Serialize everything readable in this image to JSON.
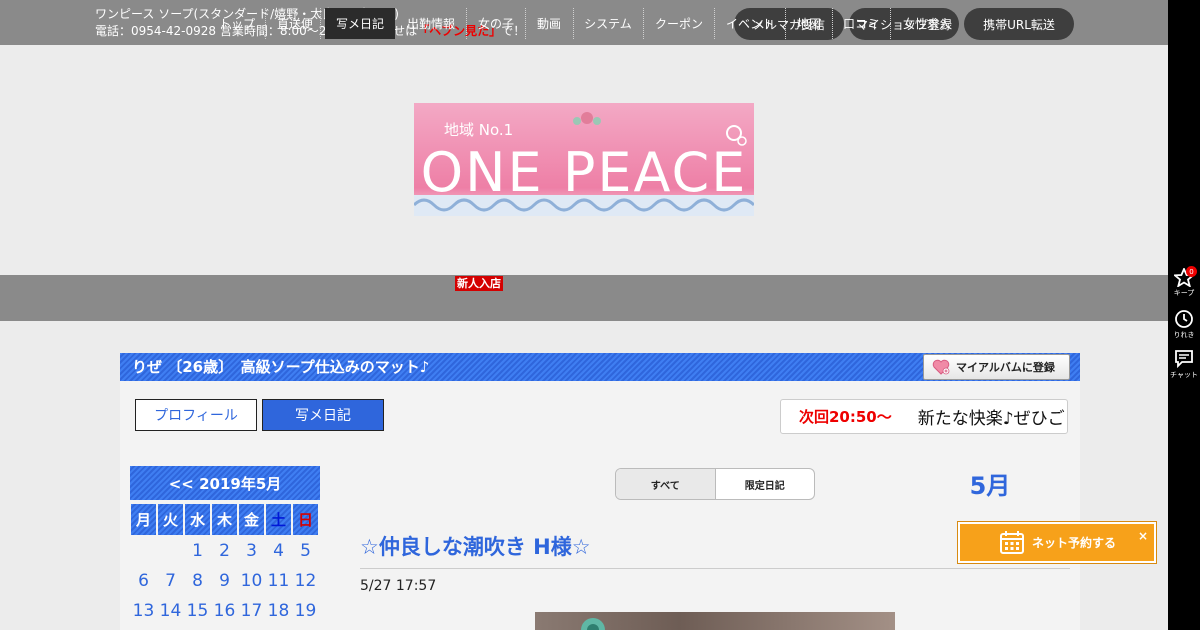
{
  "topbar": {
    "shop_line": "ワンピース ソープ(スタンダード/嬉野・太良町・白石町)",
    "contact_prefix": "電話：0954-42-0928 営業時間：8:00～24:00 お問合せは",
    "contact_highlight": "「ヘブン見た」",
    "contact_suffix": "で！",
    "buttons": [
      "メルマガ受信",
      "マイショップ登録",
      "携帯URL転送"
    ]
  },
  "logo": {
    "top_text": "地域 No.1",
    "main_text": "ONE PEACE"
  },
  "nav": {
    "items": [
      "トップ",
      "直送便",
      "写メ日記",
      "出勤情報",
      "女の子",
      "動画",
      "システム",
      "クーポン",
      "イベント",
      "地図",
      "口コミ",
      "女性求人"
    ],
    "active": "写メ日記",
    "badge": "新人入店"
  },
  "profile": {
    "title": "りぜ 〔26歳〕　高級ソープ仕込みのマット♪",
    "album_button": "マイアルバムに登録",
    "tabs": [
      "プロフィール",
      "写メ日記"
    ],
    "ticker_time": "次回20:50～",
    "ticker_msg": "新たな快楽♪ぜひご"
  },
  "calendar": {
    "header": "<< 2019年5月",
    "weekdays": [
      "月",
      "火",
      "水",
      "木",
      "金",
      "土",
      "日"
    ],
    "rows": [
      [
        "",
        "",
        "1",
        "2",
        "3",
        "4",
        "5"
      ],
      [
        "6",
        "7",
        "8",
        "9",
        "10",
        "11",
        "12"
      ],
      [
        "13",
        "14",
        "15",
        "16",
        "17",
        "18",
        "19"
      ]
    ]
  },
  "diary": {
    "filters": [
      "すべて",
      "限定日記"
    ],
    "active_filter": "すべて",
    "month": "5月",
    "post_title": "☆仲良しな潮吹き H様☆",
    "post_date": "5/27 17:57"
  },
  "reserve": {
    "label": "ネット予約する",
    "close": "×"
  },
  "sidebar": {
    "keep_label": "キープ",
    "keep_count": "0",
    "history_label": "りれき",
    "chat_label": "チャット"
  },
  "colors": {
    "accent_blue": "#2f66dc",
    "topbar_gray": "#8a8a8a",
    "reserve_orange": "#f7a11a",
    "highlight_red": "#e00000"
  }
}
